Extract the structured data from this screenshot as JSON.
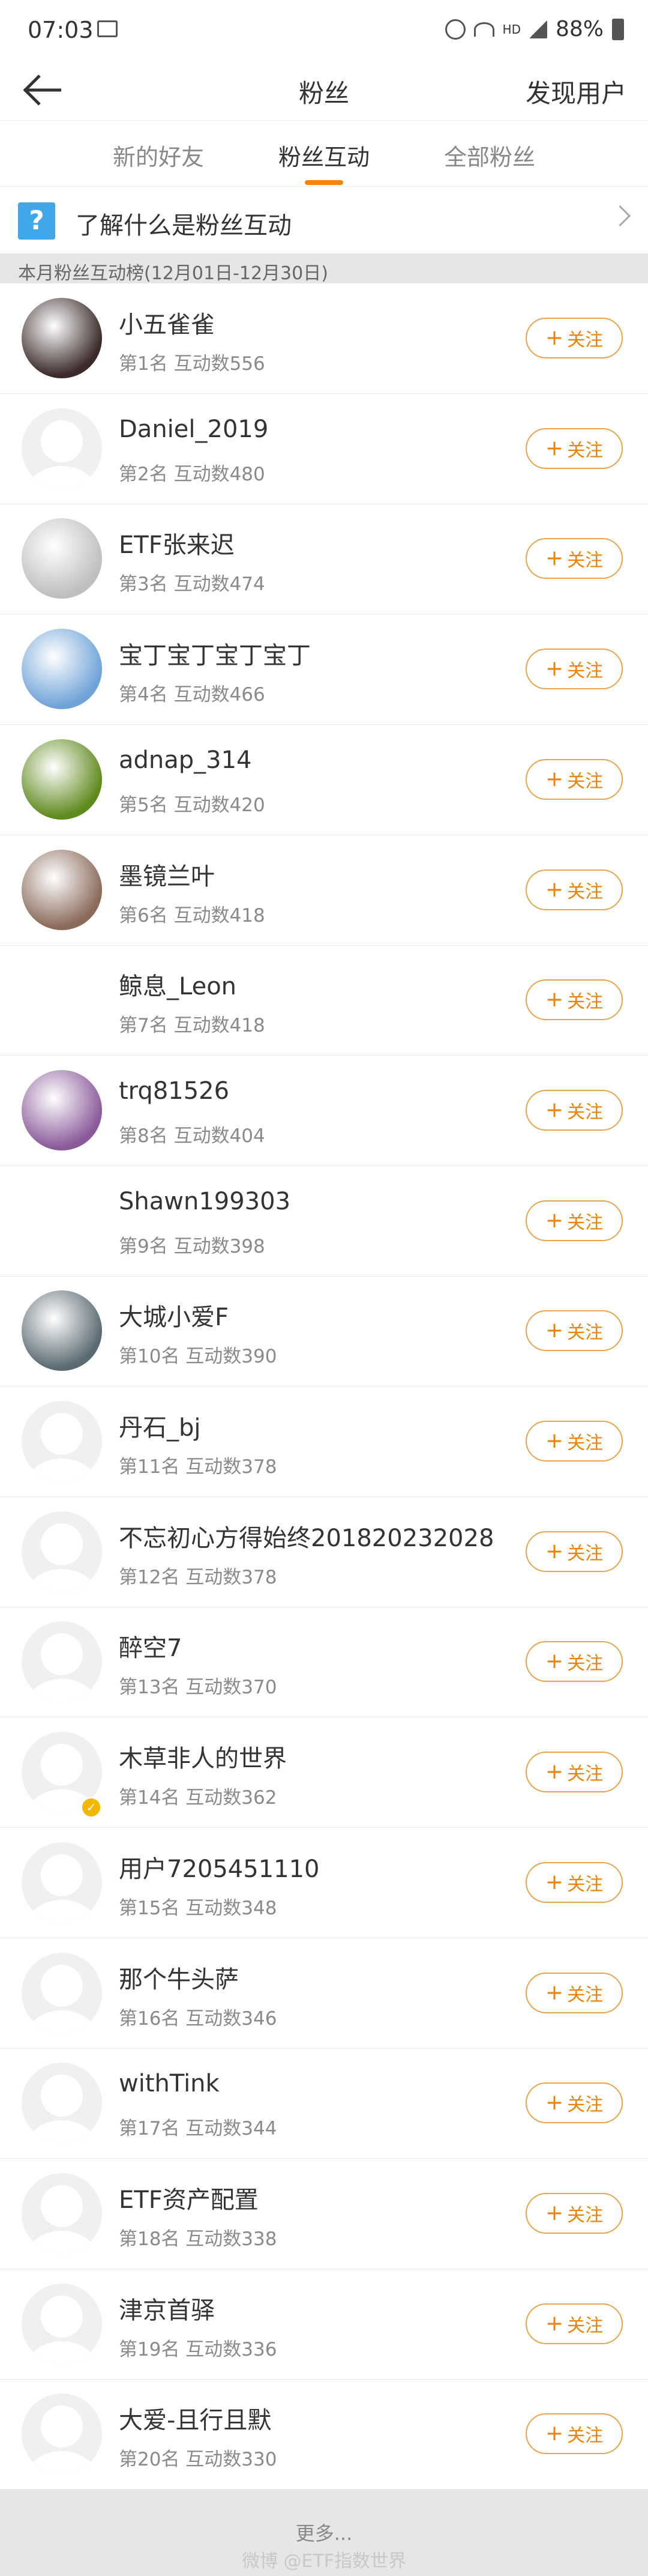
{
  "status_bar": {
    "time": "07:03",
    "network": "HD",
    "battery": "88%"
  },
  "nav": {
    "title": "粉丝",
    "right_link": "发现用户"
  },
  "tabs": [
    {
      "label": "新的好友"
    },
    {
      "label": "粉丝互动",
      "active": true
    },
    {
      "label": "全部粉丝"
    }
  ],
  "info_banner": {
    "icon_text": "?",
    "text": "了解什么是粉丝互动"
  },
  "section_header": "本月粉丝互动榜(12月01日-12月30日)",
  "follow_label": "关注",
  "fans": [
    {
      "name": "小五雀雀",
      "meta": "第1名 互动数556",
      "avatar": "photo-girl",
      "color": "#3b2a2a"
    },
    {
      "name": "Daniel_2019",
      "meta": "第2名 互动数480",
      "avatar": "default"
    },
    {
      "name": "ETF张来迟",
      "meta": "第3名 互动数474",
      "avatar": "sketch-person",
      "color": "#bfbfbf"
    },
    {
      "name": "宝丁宝丁宝丁宝丁",
      "meta": "第4名 互动数466",
      "avatar": "sky-photo",
      "color": "#6fa3d8"
    },
    {
      "name": "adnap_314",
      "meta": "第5名 互动数420",
      "avatar": "insect-photo",
      "color": "#5f8a1e"
    },
    {
      "name": "墨镜兰叶",
      "meta": "第6名 互动数418",
      "avatar": "couple-photo",
      "color": "#8a6a5a"
    },
    {
      "name": "鲸息_Leon",
      "meta": "第7名 互动数418",
      "avatar": "octocat",
      "color": "#ffffff"
    },
    {
      "name": "trq81526",
      "meta": "第8名 互动数404",
      "avatar": "flower-photo",
      "color": "#8a5a9a"
    },
    {
      "name": "Shawn199303",
      "meta": "第9名 互动数398",
      "avatar": "cartoon-face",
      "color": "#ffffff"
    },
    {
      "name": "大城小爱F",
      "meta": "第10名 互动数390",
      "avatar": "rat-cartoon",
      "color": "#5a6a72"
    },
    {
      "name": "丹石_bj",
      "meta": "第11名 互动数378",
      "avatar": "default"
    },
    {
      "name": "不忘初心方得始终201820232028",
      "meta": "第12名 互动数378",
      "avatar": "default"
    },
    {
      "name": "醉空7",
      "meta": "第13名 互动数370",
      "avatar": "default"
    },
    {
      "name": "木草非人的世界",
      "meta": "第14名 互动数362",
      "avatar": "default",
      "verified": true
    },
    {
      "name": "用户7205451110",
      "meta": "第15名 互动数348",
      "avatar": "default"
    },
    {
      "name": "那个牛头萨",
      "meta": "第16名 互动数346",
      "avatar": "default"
    },
    {
      "name": "withTink",
      "meta": "第17名 互动数344",
      "avatar": "default"
    },
    {
      "name": "ETF资产配置",
      "meta": "第18名 互动数338",
      "avatar": "default"
    },
    {
      "name": "津京首驿",
      "meta": "第19名 互动数336",
      "avatar": "default"
    },
    {
      "name": "大爱-且行且默",
      "meta": "第20名 互动数330",
      "avatar": "default"
    }
  ],
  "more": {
    "label": "更多...",
    "watermark": "微博 @ETF指数世界"
  }
}
